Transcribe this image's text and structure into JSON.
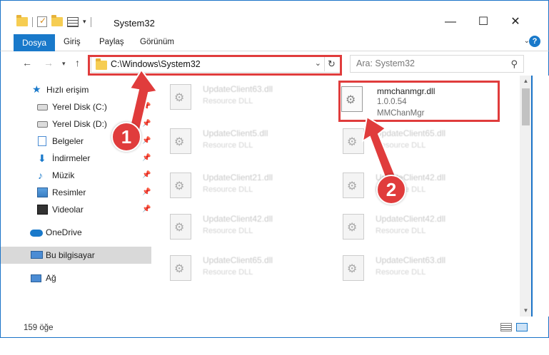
{
  "window": {
    "title": "System32",
    "minimize_glyph": "—",
    "maximize_glyph": "☐",
    "close_glyph": "✕"
  },
  "ribbon": {
    "tabs": [
      "Dosya",
      "Giriş",
      "Paylaş",
      "Görünüm"
    ],
    "expand_glyph": "⌄",
    "help_glyph": "?"
  },
  "address": {
    "path": "C:\\Windows\\System32",
    "search_placeholder": "Ara: System32"
  },
  "sidebar": {
    "items": [
      {
        "label": "Hızlı erişim",
        "icon": "star-icon"
      },
      {
        "label": "Yerel Disk (C:)",
        "icon": "drive-icon",
        "pinned": true
      },
      {
        "label": "Yerel Disk (D:)",
        "icon": "drive-icon",
        "pinned": true
      },
      {
        "label": "Belgeler",
        "icon": "documents-icon",
        "pinned": true
      },
      {
        "label": "İndirmeler",
        "icon": "downloads-icon",
        "pinned": true
      },
      {
        "label": "Müzik",
        "icon": "music-icon",
        "pinned": true
      },
      {
        "label": "Resimler",
        "icon": "pictures-icon",
        "pinned": true
      },
      {
        "label": "Videolar",
        "icon": "videos-icon",
        "pinned": true
      },
      {
        "label": "OneDrive",
        "icon": "cloud-icon"
      },
      {
        "label": "Bu bilgisayar",
        "icon": "computer-icon",
        "selected": true
      },
      {
        "label": "Ağ",
        "icon": "network-icon"
      }
    ]
  },
  "files": {
    "col1": [
      {
        "name": "UpdateClient63.dll",
        "type": "Resource DLL"
      },
      {
        "name": "UpdateClient5.dll",
        "type": "Resource DLL"
      },
      {
        "name": "UpdateClient21.dll",
        "type": "Resource DLL"
      },
      {
        "name": "UpdateClient42.dll",
        "type": "Resource DLL"
      },
      {
        "name": "UpdateClient65.dll",
        "type": "Resource DLL"
      }
    ],
    "col2": [
      {
        "name": "UpdateClient65.dll",
        "type": "Resource DLL"
      },
      {
        "name": "UpdateClient42.dll",
        "type": "Resource DLL"
      },
      {
        "name": "UpdateClient42.dll",
        "type": "Resource DLL"
      },
      {
        "name": "UpdateClient63.dll",
        "type": "Resource DLL"
      }
    ],
    "target": {
      "name": "mmchanmgr.dll",
      "version": "1.0.0.54",
      "company": "MMChanMgr"
    }
  },
  "status": {
    "count": "159 öğe"
  },
  "annotations": {
    "step1": "1",
    "step2": "2",
    "color": "#e03c3c"
  }
}
